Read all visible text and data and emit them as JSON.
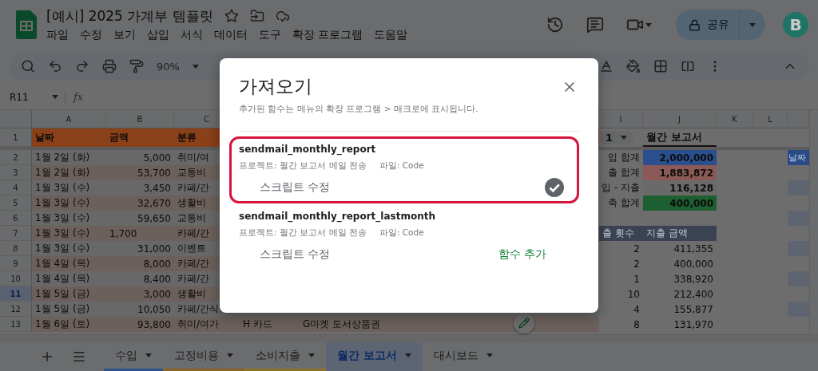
{
  "app": {
    "title": "[예시] 2025 가계부 템플릿",
    "menus": [
      "파일",
      "수정",
      "보기",
      "삽입",
      "서식",
      "데이터",
      "도구",
      "확장 프로그램",
      "도움말"
    ],
    "share": {
      "label": "공유"
    },
    "avatar": {
      "initial": "B"
    }
  },
  "toolbar": {
    "zoom": "90%"
  },
  "formula_bar": {
    "cell_ref": "R11",
    "fx": "fx"
  },
  "sheet": {
    "column_headers": [
      "A",
      "B",
      "C",
      "I",
      "J",
      "K",
      "L"
    ],
    "rows": [
      {
        "number": "1",
        "selected": false,
        "kind": "header",
        "cells": {
          "A": "날짜",
          "B": "금액",
          "C": "분류",
          "I": "1",
          "J": "월간 보고서"
        }
      },
      {
        "number": "2",
        "selected": false,
        "kind": "data",
        "cells": {
          "A": "1월 2일 (화)",
          "B": "5,000",
          "C": "취미/여",
          "I": "입 합계",
          "J": {
            "text": "2,000,000",
            "color": "#2b4f8e"
          },
          "M": "날짜"
        }
      },
      {
        "number": "3",
        "selected": false,
        "kind": "data",
        "cells": {
          "A": "1월 2일 (화)",
          "B": "53,700",
          "C": "교통비",
          "I": "출 합계",
          "J": {
            "text": "1,883,872",
            "color": "#8c5a56"
          }
        }
      },
      {
        "number": "4",
        "selected": false,
        "kind": "data",
        "cells": {
          "A": "1월 3일 (수)",
          "B": "3,450",
          "C": "카페/간",
          "I": "입 - 지출",
          "J": {
            "text": "116,128",
            "color": "#6a6a6a"
          }
        }
      },
      {
        "number": "5",
        "selected": false,
        "kind": "data",
        "cells": {
          "A": "1월 3일 (수)",
          "B": "32,670",
          "C": "생활비",
          "I": "축 합계",
          "J": {
            "text": "400,000",
            "color": "#1d5f30"
          }
        }
      },
      {
        "number": "6",
        "selected": false,
        "kind": "data",
        "cells": {
          "A": "1월 3일 (수)",
          "B": "59,650",
          "C": "교통비"
        }
      },
      {
        "number": "7",
        "selected": false,
        "kind": "section",
        "cells": {
          "A": "1월 3일 (수)",
          "B": "1,700",
          "C": "카페/간",
          "I": "출 횟수",
          "J": "지출 금액"
        }
      },
      {
        "number": "8",
        "selected": false,
        "kind": "data",
        "cells": {
          "A": "1월 3일 (수)",
          "B": "31,000",
          "C": "이벤트",
          "I": "2",
          "J": "411,355"
        }
      },
      {
        "number": "9",
        "selected": false,
        "kind": "data",
        "cells": {
          "A": "1월 4일 (목)",
          "B": "8,000",
          "C": "카페/간",
          "I": "2",
          "J": "400,000"
        }
      },
      {
        "number": "10",
        "selected": false,
        "kind": "data",
        "cells": {
          "A": "1월 4일 (목)",
          "B": "8,400",
          "C": "카페/간",
          "I": "1",
          "J": "338,920"
        }
      },
      {
        "number": "11",
        "selected": true,
        "kind": "data",
        "cells": {
          "A": "1월 5일 (금)",
          "B": "3,000",
          "C": "생활비",
          "I": "10",
          "J": "212,400"
        }
      },
      {
        "number": "12",
        "selected": false,
        "kind": "data",
        "cells": {
          "A": "1월 5일 (금)",
          "B": "10,050",
          "C": "카페/간식",
          "I": "4",
          "J": "155,877"
        }
      },
      {
        "number": "13",
        "selected": false,
        "kind": "data",
        "cells": {
          "A": "1월 6일 (토)",
          "B": "93,800",
          "C": "취미/여가",
          "D": "H 카드",
          "E": "G마켓 도서상품권",
          "I": "8",
          "J": "131,970"
        }
      }
    ]
  },
  "sheet_tabs": [
    {
      "label": "수입",
      "selected": false,
      "color": "#2c5290"
    },
    {
      "label": "고정비용",
      "selected": false,
      "color": "#8c6526"
    },
    {
      "label": "소비지출",
      "selected": false,
      "color": "#8c7424"
    },
    {
      "label": "월간 보고서",
      "selected": true
    },
    {
      "label": "대시보드",
      "selected": false
    }
  ],
  "dialog": {
    "title": "가져오기",
    "subtitle": "추가된 함수는 메뉴의 확장 프로그램 > 매크로에 표시됩니다.",
    "functions": [
      {
        "name": "sendmail_monthly_report",
        "project": "프로젝트: 월간 보고서 메일 전송",
        "file": "파일: Code",
        "edit_label": "스크립트 수정",
        "added": true,
        "highlighted": true
      },
      {
        "name": "sendmail_monthly_report_lastmonth",
        "project": "프로젝트: 월간 보고서 메일 전송",
        "file": "파일: Code",
        "edit_label": "스크립트 수정",
        "added": false,
        "add_label": "함수 추가",
        "highlighted": false
      }
    ]
  }
}
